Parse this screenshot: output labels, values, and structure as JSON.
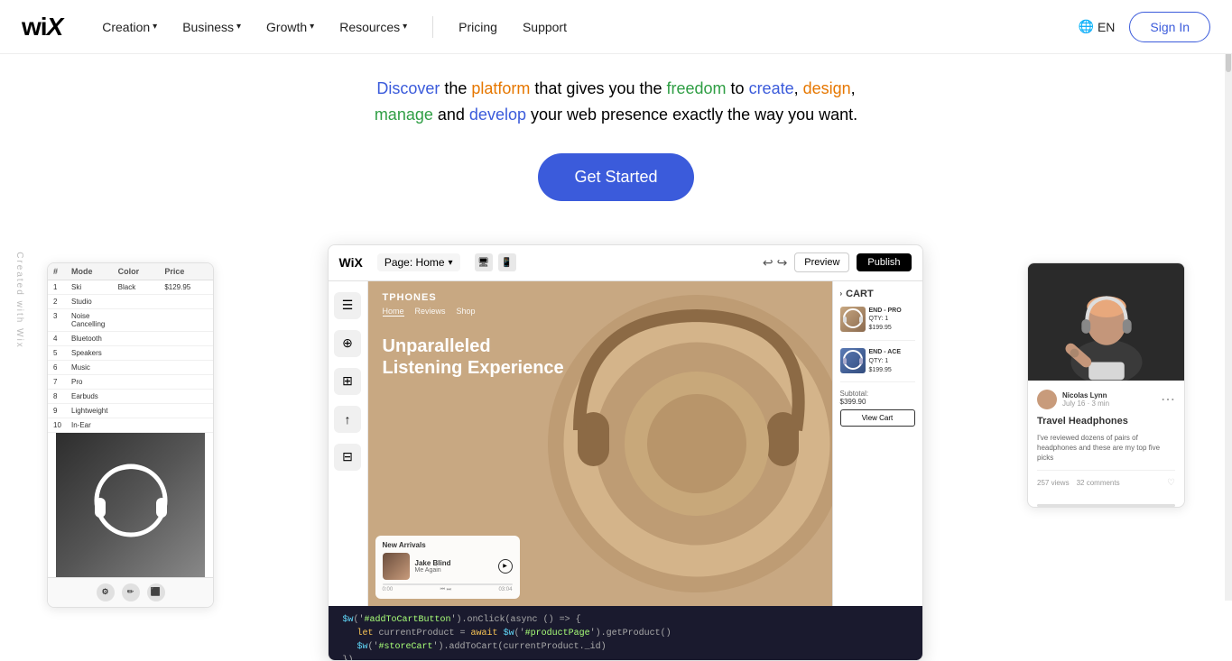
{
  "navbar": {
    "logo": "Wix",
    "nav_items": [
      {
        "label": "Creation",
        "has_dropdown": true
      },
      {
        "label": "Business",
        "has_dropdown": true
      },
      {
        "label": "Growth",
        "has_dropdown": true
      },
      {
        "label": "Resources",
        "has_dropdown": true
      }
    ],
    "plain_items": [
      {
        "label": "Pricing"
      },
      {
        "label": "Support"
      }
    ],
    "lang": "EN",
    "sign_in": "Sign In"
  },
  "hero": {
    "subtitle_parts": {
      "line1": "Discover the platform that gives you the freedom to create, design,",
      "line2": "manage and develop your web presence exactly the way you want."
    },
    "cta": "Get Started"
  },
  "editor": {
    "wix_logo": "WiX",
    "page_selector": "Page: Home",
    "preview_btn": "Preview",
    "publish_btn": "Publish",
    "store": {
      "name": "TPHONES",
      "nav": [
        "Home",
        "Reviews",
        "Shop"
      ],
      "headline_line1": "Unparalleled",
      "headline_line2": "Listening Experience"
    },
    "new_arrivals": {
      "label": "New Arrivals",
      "song": "Jake Blind",
      "artist": "Me Again",
      "time_current": "0:00",
      "time_total": "03:04"
    },
    "cart": {
      "title": "CART",
      "items": [
        {
          "name": "END - PRO",
          "qty": "QTY: 1",
          "price": "$199.95"
        },
        {
          "name": "END - ACE",
          "qty": "QTY: 1",
          "price": "$199.95"
        }
      ],
      "subtotal_label": "Subtotal:",
      "subtotal": "$399.90",
      "view_cart": "View Cart"
    },
    "code": [
      "$w('#addToCartButton').onClick(async () => {",
      "  let currentProduct = await $w('#productPage').getProduct()",
      "  $w('#storeCart').addToCart(currentProduct._id)",
      "})"
    ]
  },
  "left_panel": {
    "headers": [
      "",
      "Mode",
      "Color",
      "Price"
    ],
    "rows": [
      [
        "1",
        "Ski",
        "Black",
        "$129.95"
      ],
      [
        "2",
        "Studio",
        "",
        ""
      ],
      [
        "3",
        "Noise Cancelling",
        "",
        ""
      ],
      [
        "4",
        "Bluetooth",
        "",
        ""
      ],
      [
        "5",
        "Speakers",
        "",
        ""
      ],
      [
        "6",
        "Music",
        "",
        ""
      ],
      [
        "7",
        "Pro",
        "",
        ""
      ],
      [
        "8",
        "Earbuds",
        "",
        ""
      ],
      [
        "9",
        "Lightweight",
        "",
        ""
      ],
      [
        "10",
        "In-Ear",
        "",
        ""
      ]
    ]
  },
  "blog": {
    "author_name": "Nicolas Lynn",
    "author_date": "July 16 · 3 min",
    "title": "Travel Headphones",
    "excerpt": "I've reviewed dozens of pairs of headphones and these are my top five picks",
    "views": "257 views",
    "comments": "32 comments"
  },
  "side_label": "Created with Wix"
}
